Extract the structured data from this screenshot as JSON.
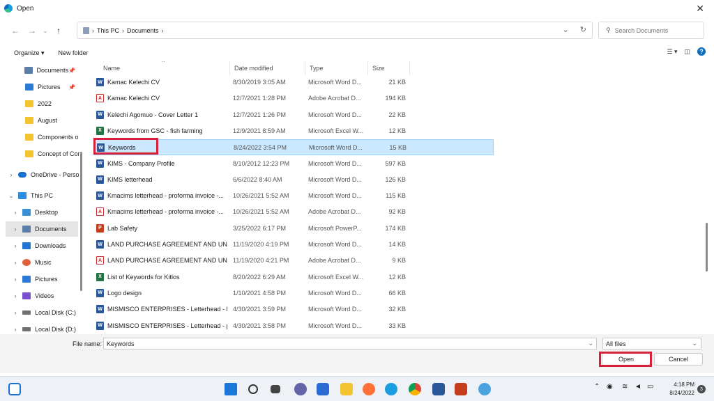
{
  "window": {
    "title": "Open"
  },
  "address": {
    "crumbs": [
      "This PC",
      "Documents"
    ]
  },
  "search": {
    "placeholder": "Search Documents"
  },
  "toolbar": {
    "organize": "Organize ▾",
    "new_folder": "New folder"
  },
  "sidebar": {
    "items": [
      {
        "label": "Documents",
        "icon": "documents-icon",
        "pinned": true
      },
      {
        "label": "Pictures",
        "icon": "pictures-icon",
        "pinned": true
      },
      {
        "label": "2022",
        "icon": "folder-icon"
      },
      {
        "label": "August",
        "icon": "folder-icon"
      },
      {
        "label": "Components o",
        "icon": "folder-icon"
      },
      {
        "label": "Concept of Cor",
        "icon": "folder-icon"
      },
      {
        "label": "OneDrive - Perso",
        "icon": "onedrive-icon"
      },
      {
        "label": "This PC",
        "icon": "pc-icon"
      },
      {
        "label": "Desktop",
        "icon": "desktop-icon"
      },
      {
        "label": "Documents",
        "icon": "documents-icon",
        "selected": true
      },
      {
        "label": "Downloads",
        "icon": "downloads-icon"
      },
      {
        "label": "Music",
        "icon": "music-icon"
      },
      {
        "label": "Pictures",
        "icon": "pictures-icon"
      },
      {
        "label": "Videos",
        "icon": "videos-icon"
      },
      {
        "label": "Local Disk (C:)",
        "icon": "disk-icon"
      },
      {
        "label": "Local Disk (D:)",
        "icon": "disk-icon"
      }
    ]
  },
  "columns": {
    "name": "Name",
    "date": "Date modified",
    "type": "Type",
    "size": "Size"
  },
  "files": [
    {
      "name": "Kamac Kelechi CV",
      "date": "8/30/2019 3:05 AM",
      "type": "Microsoft Word D...",
      "size": "21 KB",
      "kind": "word"
    },
    {
      "name": "Kamac Kelechi CV",
      "date": "12/7/2021 1:28 PM",
      "type": "Adobe Acrobat D...",
      "size": "194 KB",
      "kind": "pdf"
    },
    {
      "name": "Kelechi Agomuo - Cover Letter 1",
      "date": "12/7/2021 1:26 PM",
      "type": "Microsoft Word D...",
      "size": "22 KB",
      "kind": "word"
    },
    {
      "name": "Keywords from GSC - fish farming",
      "date": "12/9/2021 8:59 AM",
      "type": "Microsoft Excel W...",
      "size": "12 KB",
      "kind": "excel"
    },
    {
      "name": "Keywords",
      "date": "8/24/2022 3:54 PM",
      "type": "Microsoft Word D...",
      "size": "15 KB",
      "kind": "word",
      "selected": true
    },
    {
      "name": "KIMS - Company Profile",
      "date": "8/10/2012 12:23 PM",
      "type": "Microsoft Word D...",
      "size": "597 KB",
      "kind": "word"
    },
    {
      "name": "KIMS letterhead",
      "date": "6/6/2022 8:40 AM",
      "type": "Microsoft Word D...",
      "size": "126 KB",
      "kind": "word"
    },
    {
      "name": "Kmacims letterhead - proforma invoice -...",
      "date": "10/26/2021 5:52 AM",
      "type": "Microsoft Word D...",
      "size": "115 KB",
      "kind": "word"
    },
    {
      "name": "Kmacims letterhead - proforma invoice -...",
      "date": "10/26/2021 5:52 AM",
      "type": "Adobe Acrobat D...",
      "size": "92 KB",
      "kind": "pdf"
    },
    {
      "name": "Lab Safety",
      "date": "3/25/2022 6:17 PM",
      "type": "Microsoft PowerP...",
      "size": "174 KB",
      "kind": "ppt"
    },
    {
      "name": "LAND PURCHASE AGREEMENT AND UN...",
      "date": "11/19/2020 4:19 PM",
      "type": "Microsoft Word D...",
      "size": "14 KB",
      "kind": "word"
    },
    {
      "name": "LAND PURCHASE AGREEMENT AND UN...",
      "date": "11/19/2020 4:21 PM",
      "type": "Adobe Acrobat D...",
      "size": "9 KB",
      "kind": "pdf"
    },
    {
      "name": "List of Keywords for Kitlos",
      "date": "8/20/2022 6:29 AM",
      "type": "Microsoft Excel W...",
      "size": "12 KB",
      "kind": "excel"
    },
    {
      "name": "Logo design",
      "date": "1/10/2021 4:58 PM",
      "type": "Microsoft Word D...",
      "size": "66 KB",
      "kind": "word"
    },
    {
      "name": "MISMISCO ENTERPRISES - Letterhead - Pig",
      "date": "4/30/2021 3:59 PM",
      "type": "Microsoft Word D...",
      "size": "32 KB",
      "kind": "word"
    },
    {
      "name": "MISMISCO ENTERPRISES - Letterhead - pkc",
      "date": "4/30/2021 3:58 PM",
      "type": "Microsoft Word D...",
      "size": "33 KB",
      "kind": "word"
    }
  ],
  "bottom": {
    "file_name_label": "File name:",
    "file_name_value": "Keywords",
    "file_type": "All files",
    "open_label": "Open",
    "cancel_label": "Cancel"
  },
  "taskbar": {
    "time": "4:18 PM",
    "date": "8/24/2022",
    "notifications": "3"
  },
  "colors": {
    "accent": "#0f6cbd",
    "selection": "#cce8ff",
    "highlight": "#d8203a"
  }
}
